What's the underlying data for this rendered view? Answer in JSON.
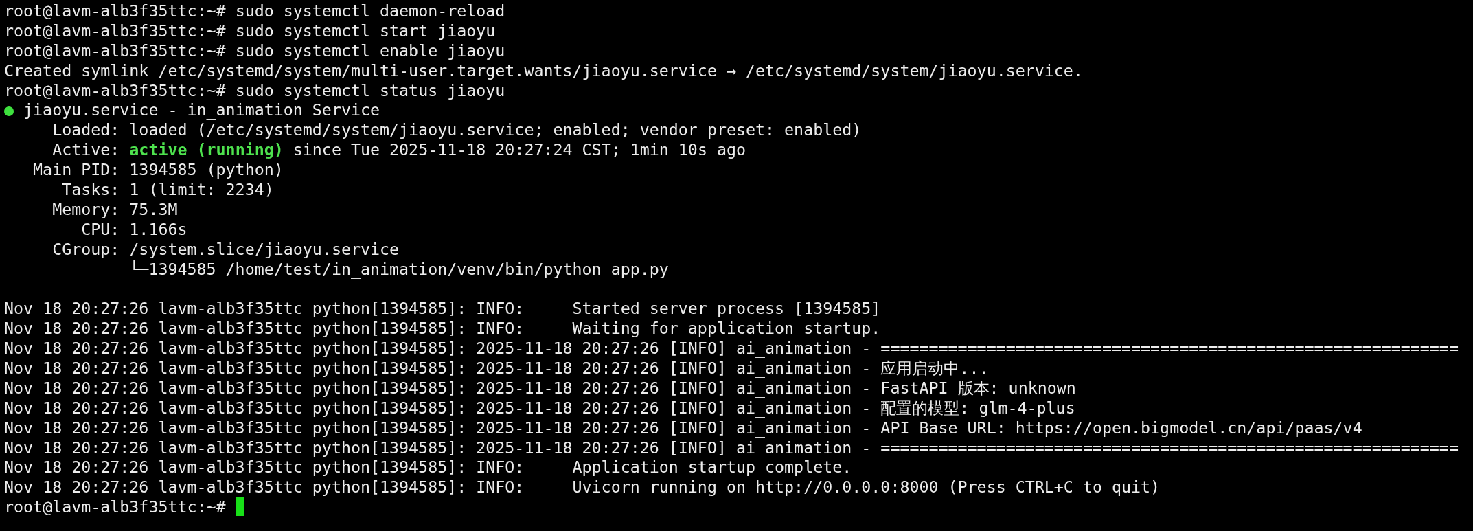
{
  "terminal": {
    "lines": [
      {
        "kind": "prompt",
        "prompt": "root@lavm-alb3f35ttc:~#",
        "command": "sudo systemctl daemon-reload"
      },
      {
        "kind": "prompt",
        "prompt": "root@lavm-alb3f35ttc:~#",
        "command": "sudo systemctl start jiaoyu"
      },
      {
        "kind": "prompt",
        "prompt": "root@lavm-alb3f35ttc:~#",
        "command": "sudo systemctl enable jiaoyu"
      },
      {
        "kind": "text",
        "text": "Created symlink /etc/systemd/system/multi-user.target.wants/jiaoyu.service → /etc/systemd/system/jiaoyu.service."
      },
      {
        "kind": "prompt",
        "prompt": "root@lavm-alb3f35ttc:~#",
        "command": "sudo systemctl status jiaoyu"
      },
      {
        "kind": "unit",
        "bullet": "●",
        "color": "#3ee03e",
        "text": "jiaoyu.service - in_animation Service"
      },
      {
        "kind": "text",
        "text": "     Loaded: loaded (/etc/systemd/system/jiaoyu.service; enabled; vendor preset: enabled)"
      },
      {
        "kind": "active",
        "label": "     Active:",
        "state": "active (running)",
        "rest": "since Tue 2025-11-18 20:27:24 CST; 1min 10s ago"
      },
      {
        "kind": "text",
        "text": "   Main PID: 1394585 (python)"
      },
      {
        "kind": "text",
        "text": "      Tasks: 1 (limit: 2234)"
      },
      {
        "kind": "text",
        "text": "     Memory: 75.3M"
      },
      {
        "kind": "text",
        "text": "        CPU: 1.166s"
      },
      {
        "kind": "text",
        "text": "     CGroup: /system.slice/jiaoyu.service"
      },
      {
        "kind": "text",
        "text": "             └─1394585 /home/test/in_animation/venv/bin/python app.py"
      },
      {
        "kind": "blank"
      },
      {
        "kind": "text",
        "text": "Nov 18 20:27:26 lavm-alb3f35ttc python[1394585]: INFO:     Started server process [1394585]"
      },
      {
        "kind": "text",
        "text": "Nov 18 20:27:26 lavm-alb3f35ttc python[1394585]: INFO:     Waiting for application startup."
      },
      {
        "kind": "text",
        "text": "Nov 18 20:27:26 lavm-alb3f35ttc python[1394585]: 2025-11-18 20:27:26 [INFO] ai_animation - ============================================================"
      },
      {
        "kind": "text",
        "text": "Nov 18 20:27:26 lavm-alb3f35ttc python[1394585]: 2025-11-18 20:27:26 [INFO] ai_animation - 应用启动中..."
      },
      {
        "kind": "text",
        "text": "Nov 18 20:27:26 lavm-alb3f35ttc python[1394585]: 2025-11-18 20:27:26 [INFO] ai_animation - FastAPI 版本: unknown"
      },
      {
        "kind": "text",
        "text": "Nov 18 20:27:26 lavm-alb3f35ttc python[1394585]: 2025-11-18 20:27:26 [INFO] ai_animation - 配置的模型: glm-4-plus"
      },
      {
        "kind": "text",
        "text": "Nov 18 20:27:26 lavm-alb3f35ttc python[1394585]: 2025-11-18 20:27:26 [INFO] ai_animation - API Base URL: https://open.bigmodel.cn/api/paas/v4"
      },
      {
        "kind": "text",
        "text": "Nov 18 20:27:26 lavm-alb3f35ttc python[1394585]: 2025-11-18 20:27:26 [INFO] ai_animation - ============================================================"
      },
      {
        "kind": "text",
        "text": "Nov 18 20:27:26 lavm-alb3f35ttc python[1394585]: INFO:     Application startup complete."
      },
      {
        "kind": "text",
        "text": "Nov 18 20:27:26 lavm-alb3f35ttc python[1394585]: INFO:     Uvicorn running on http://0.0.0.0:8000 (Press CTRL+C to quit)"
      },
      {
        "kind": "input",
        "prompt": "root@lavm-alb3f35ttc:~#"
      }
    ]
  }
}
